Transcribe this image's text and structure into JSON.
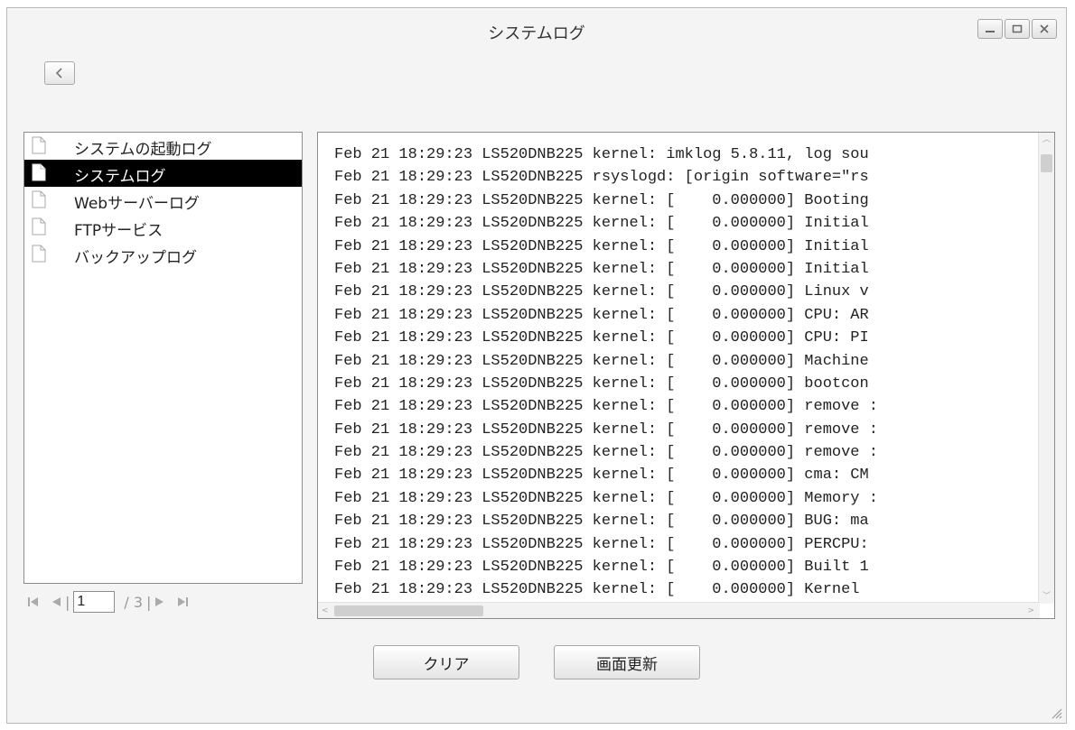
{
  "window": {
    "title": "システムログ"
  },
  "log_types": [
    {
      "label": "システムの起動ログ",
      "selected": false
    },
    {
      "label": "システムログ",
      "selected": true
    },
    {
      "label": "Webサーバーログ",
      "selected": false
    },
    {
      "label": "FTPサービス",
      "selected": false
    },
    {
      "label": "バックアップログ",
      "selected": false
    }
  ],
  "pager": {
    "current_page": "1",
    "total": "/ 3"
  },
  "log_lines": [
    "Feb 21 18:29:23 LS520DNB225 kernel: imklog 5.8.11, log sou",
    "Feb 21 18:29:23 LS520DNB225 rsyslogd: [origin software=\"rs",
    "Feb 21 18:29:23 LS520DNB225 kernel: [    0.000000] Booting",
    "Feb 21 18:29:23 LS520DNB225 kernel: [    0.000000] Initial",
    "Feb 21 18:29:23 LS520DNB225 kernel: [    0.000000] Initial",
    "Feb 21 18:29:23 LS520DNB225 kernel: [    0.000000] Initial",
    "Feb 21 18:29:23 LS520DNB225 kernel: [    0.000000] Linux v",
    "Feb 21 18:29:23 LS520DNB225 kernel: [    0.000000] CPU: AR",
    "Feb 21 18:29:23 LS520DNB225 kernel: [    0.000000] CPU: PI",
    "Feb 21 18:29:23 LS520DNB225 kernel: [    0.000000] Machine",
    "Feb 21 18:29:23 LS520DNB225 kernel: [    0.000000] bootcon",
    "Feb 21 18:29:23 LS520DNB225 kernel: [    0.000000] remove :",
    "Feb 21 18:29:23 LS520DNB225 kernel: [    0.000000] remove :",
    "Feb 21 18:29:23 LS520DNB225 kernel: [    0.000000] remove :",
    "Feb 21 18:29:23 LS520DNB225 kernel: [    0.000000] cma: CM",
    "Feb 21 18:29:23 LS520DNB225 kernel: [    0.000000] Memory :",
    "Feb 21 18:29:23 LS520DNB225 kernel: [    0.000000] BUG: ma",
    "Feb 21 18:29:23 LS520DNB225 kernel: [    0.000000] PERCPU:",
    "Feb 21 18:29:23 LS520DNB225 kernel: [    0.000000] Built 1",
    "Feb 21 18:29:23 LS520DNB225 kernel: [    0.000000] Kernel"
  ],
  "buttons": {
    "clear": "クリア",
    "refresh": "画面更新"
  },
  "icons": {
    "back": "chevron-left-icon",
    "doc": "document-icon",
    "first": "first-page-icon",
    "prev": "prev-page-icon",
    "next": "next-page-icon",
    "last": "last-page-icon",
    "minimize": "minimize-icon",
    "maximize": "maximize-icon",
    "close": "close-icon",
    "resize": "resize-grip-icon"
  }
}
